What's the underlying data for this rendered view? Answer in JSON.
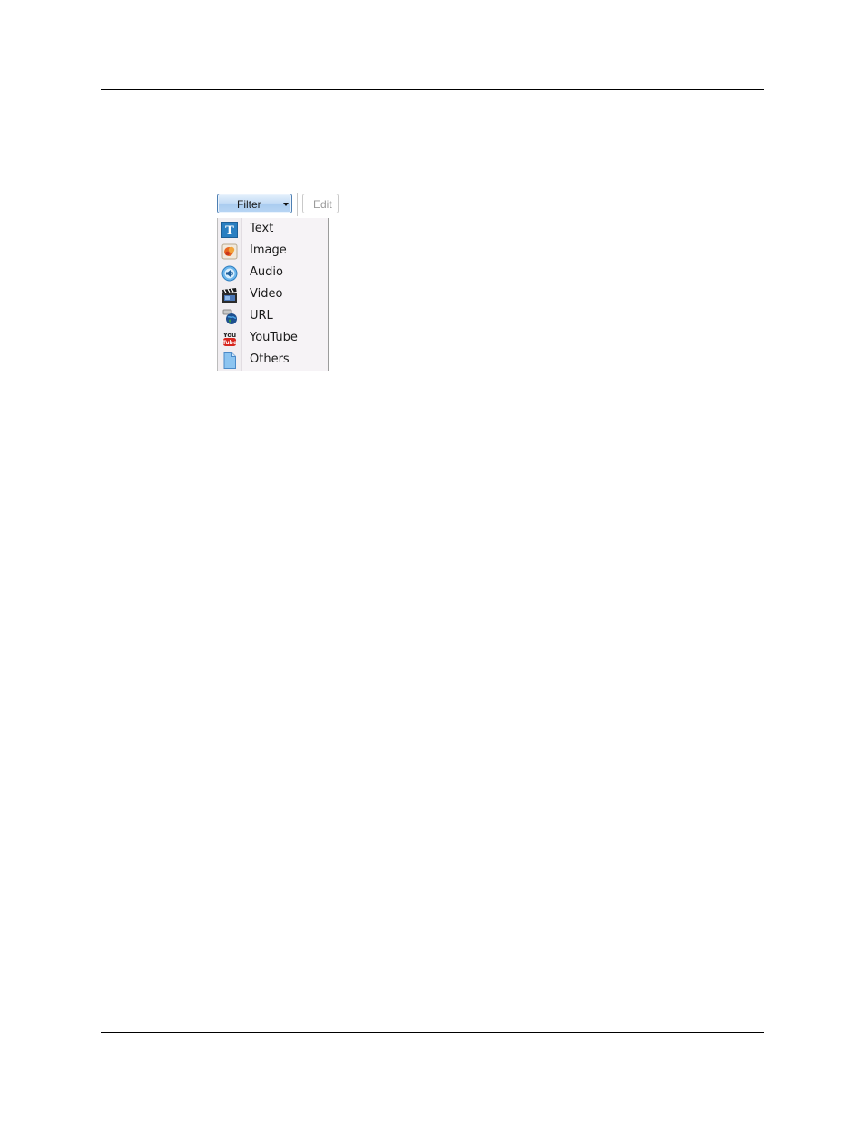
{
  "toolbar": {
    "filter_label": "Filter",
    "edit_label": "Edit"
  },
  "filter_menu": {
    "items": [
      {
        "label": "Text",
        "icon": "text-type-icon"
      },
      {
        "label": "Image",
        "icon": "image-icon"
      },
      {
        "label": "Audio",
        "icon": "audio-speaker-icon"
      },
      {
        "label": "Video",
        "icon": "video-clapper-icon"
      },
      {
        "label": "URL",
        "icon": "url-globe-icon"
      },
      {
        "label": "YouTube",
        "icon": "youtube-icon"
      },
      {
        "label": "Others",
        "icon": "document-icon"
      }
    ]
  },
  "colors": {
    "filter_button_border": "#4d7fb3",
    "menu_background": "#f6f3f6",
    "text_icon_blue": "#2a7fc1",
    "youtube_red": "#d7261e"
  }
}
